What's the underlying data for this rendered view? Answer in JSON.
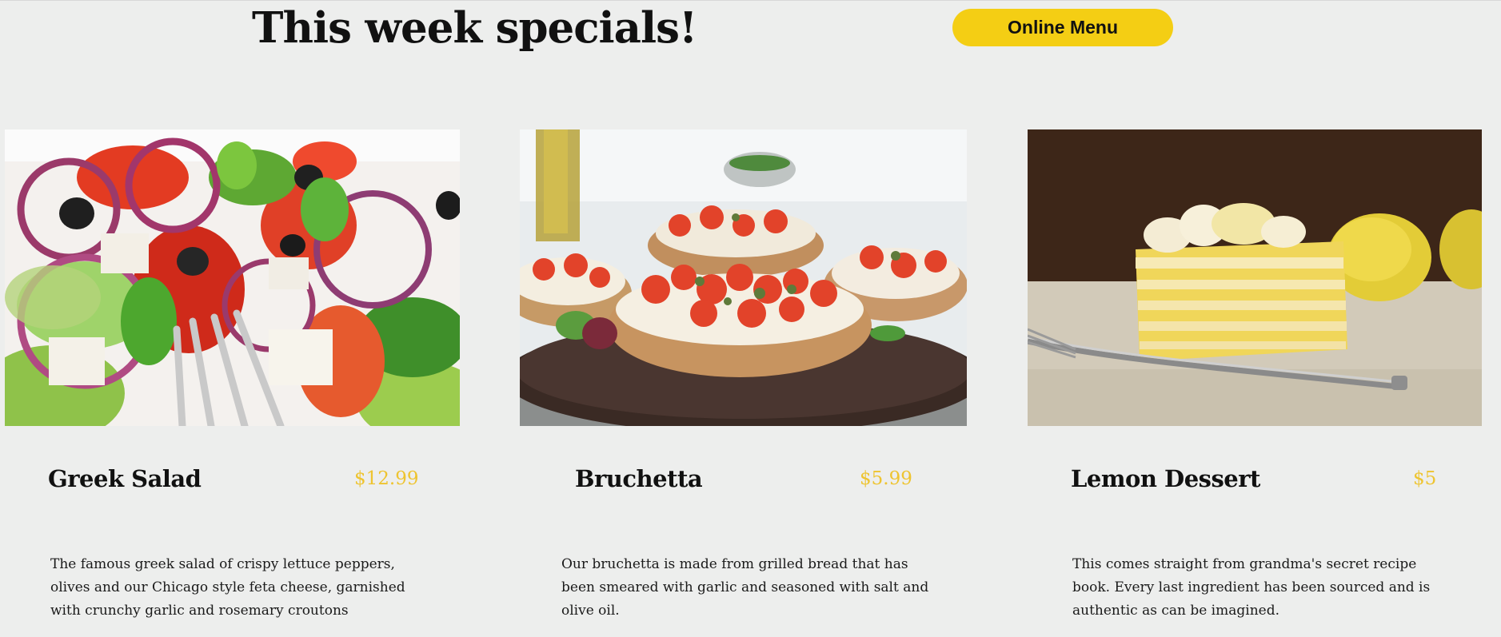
{
  "header": {
    "title": "This week specials!",
    "menu_button_label": "Online Menu"
  },
  "colors": {
    "background": "#edeeed",
    "accent_yellow": "#f4ce14",
    "price": "#eec430",
    "text": "#111111"
  },
  "specials": [
    {
      "name": "Greek Salad",
      "price": "$12.99",
      "description": "The famous greek salad of crispy lettuce peppers, olives and our Chicago style feta cheese, garnished with crunchy garlic and rosemary croutons",
      "image": "greek-salad-photo"
    },
    {
      "name": "Bruchetta",
      "price": "$5.99",
      "description": "Our bruchetta is made from grilled bread that has been smeared with garlic and seasoned with salt and olive oil.",
      "image": "bruchetta-photo"
    },
    {
      "name": "Lemon Dessert",
      "price": "$5",
      "description": "This comes straight from grandma's secret recipe book. Every last ingredient has been sourced and is authentic as can be imagined.",
      "image": "lemon-dessert-photo"
    }
  ]
}
